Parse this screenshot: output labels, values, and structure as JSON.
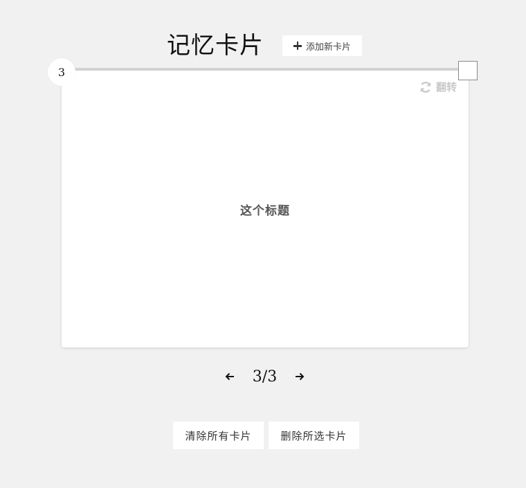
{
  "header": {
    "title": "记忆卡片",
    "add_button_label": "添加新卡片"
  },
  "card": {
    "number": "3",
    "flip_label": "翻转",
    "title": "这个标题",
    "selected": false
  },
  "pager": {
    "indicator": "3/3"
  },
  "actions": {
    "clear_all_label": "清除所有卡片",
    "delete_selected_label": "删除所选卡片"
  },
  "icons": {
    "add": "plus-icon",
    "flip": "refresh-icon",
    "prev": "arrow-left-icon",
    "next": "arrow-right-icon"
  },
  "colors": {
    "background": "#f1f1f2",
    "card": "#ffffff",
    "flip_text": "#c9c9cb",
    "title_text": "#555555"
  }
}
